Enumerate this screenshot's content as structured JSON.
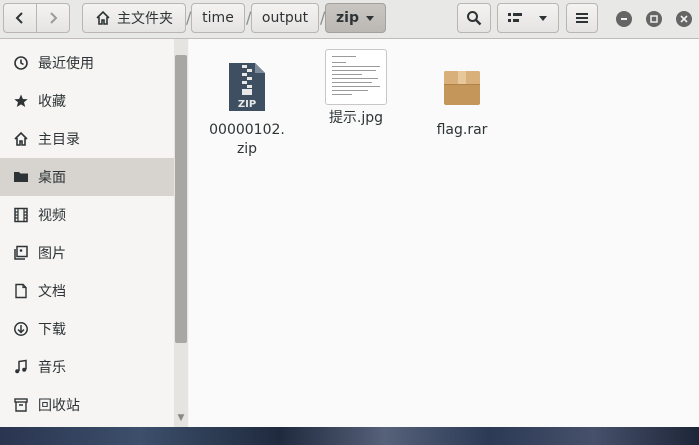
{
  "header": {
    "breadcrumbs": [
      {
        "label": "主文件夹",
        "icon": "home-icon"
      },
      {
        "label": "time"
      },
      {
        "label": "output"
      },
      {
        "label": "zip",
        "current": true
      }
    ],
    "separator": "/"
  },
  "sidebar": {
    "items": [
      {
        "label": "最近使用",
        "icon": "recent-icon"
      },
      {
        "label": "收藏",
        "icon": "star-icon"
      },
      {
        "label": "主目录",
        "icon": "home-icon"
      },
      {
        "label": "桌面",
        "icon": "folder-icon",
        "active": true
      },
      {
        "label": "视频",
        "icon": "video-icon"
      },
      {
        "label": "图片",
        "icon": "picture-icon"
      },
      {
        "label": "文档",
        "icon": "document-icon"
      },
      {
        "label": "下载",
        "icon": "download-icon"
      },
      {
        "label": "音乐",
        "icon": "music-icon"
      },
      {
        "label": "回收站",
        "icon": "trash-icon"
      }
    ]
  },
  "files": [
    {
      "line1": "00000102.",
      "line2": "zip",
      "icon": "zip-archive-icon"
    },
    {
      "line1": "提示.jpg",
      "line2": "",
      "icon": "image-thumbnail"
    },
    {
      "line1": "flag.rar",
      "line2": "",
      "icon": "rar-archive-icon"
    }
  ],
  "colors": {
    "accent_active": "#d7d4d0",
    "zip_icon": "#3d4f61",
    "rar_icon": "#c4965a"
  }
}
